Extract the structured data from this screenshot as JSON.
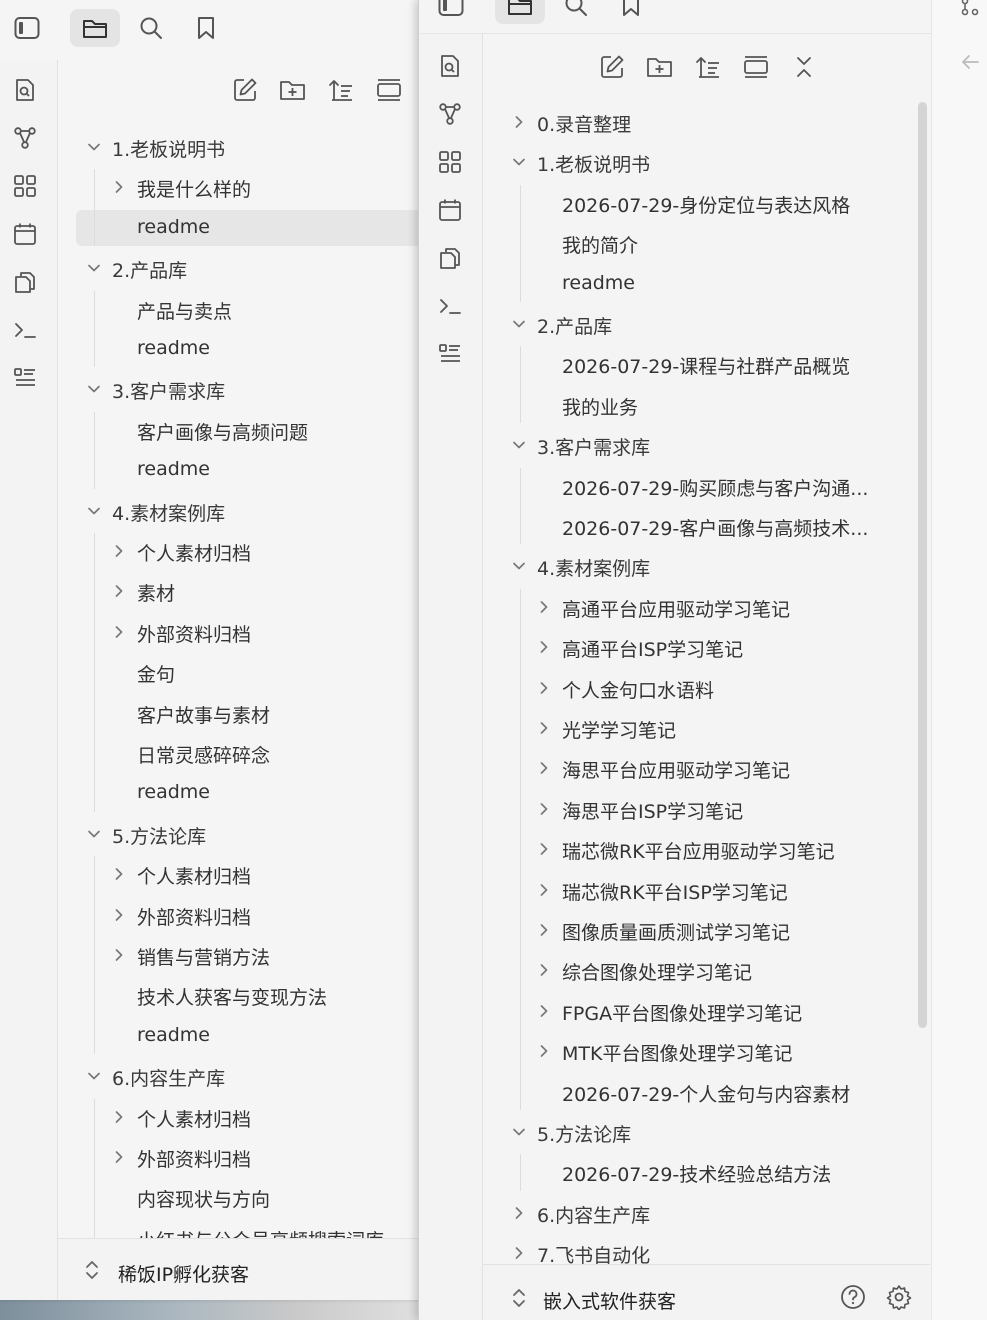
{
  "window_left": {
    "ribbon_icons": [
      "search-file-icon",
      "graph-icon",
      "canvas-icon",
      "calendar-icon",
      "copy-icon",
      "terminal-icon",
      "list-icon"
    ],
    "top_tabs": [
      "sidebar-toggle-icon",
      "folder-icon",
      "search-icon",
      "bookmark-icon"
    ],
    "nav_buttons": [
      "new-note-icon",
      "new-folder-icon",
      "sort-icon",
      "collapse-icon"
    ],
    "tree": [
      {
        "label": "1.老板说明书",
        "level": 0,
        "chevron": "down"
      },
      {
        "label": "我是什么样的",
        "level": 1,
        "chevron": "right"
      },
      {
        "label": "readme",
        "level": 1,
        "chevron": "none",
        "selected": true
      },
      {
        "label": "2.产品库",
        "level": 0,
        "chevron": "down"
      },
      {
        "label": "产品与卖点",
        "level": 1,
        "chevron": "none"
      },
      {
        "label": "readme",
        "level": 1,
        "chevron": "none"
      },
      {
        "label": "3.客户需求库",
        "level": 0,
        "chevron": "down"
      },
      {
        "label": "客户画像与高频问题",
        "level": 1,
        "chevron": "none"
      },
      {
        "label": "readme",
        "level": 1,
        "chevron": "none"
      },
      {
        "label": "4.素材案例库",
        "level": 0,
        "chevron": "down"
      },
      {
        "label": "个人素材归档",
        "level": 1,
        "chevron": "right"
      },
      {
        "label": "素材",
        "level": 1,
        "chevron": "right"
      },
      {
        "label": "外部资料归档",
        "level": 1,
        "chevron": "right"
      },
      {
        "label": "金句",
        "level": 1,
        "chevron": "none"
      },
      {
        "label": "客户故事与素材",
        "level": 1,
        "chevron": "none"
      },
      {
        "label": "日常灵感碎碎念",
        "level": 1,
        "chevron": "none"
      },
      {
        "label": "readme",
        "level": 1,
        "chevron": "none"
      },
      {
        "label": "5.方法论库",
        "level": 0,
        "chevron": "down"
      },
      {
        "label": "个人素材归档",
        "level": 1,
        "chevron": "right"
      },
      {
        "label": "外部资料归档",
        "level": 1,
        "chevron": "right"
      },
      {
        "label": "销售与营销方法",
        "level": 1,
        "chevron": "right"
      },
      {
        "label": "技术人获客与变现方法",
        "level": 1,
        "chevron": "none"
      },
      {
        "label": "readme",
        "level": 1,
        "chevron": "none"
      },
      {
        "label": "6.内容生产库",
        "level": 0,
        "chevron": "down"
      },
      {
        "label": "个人素材归档",
        "level": 1,
        "chevron": "right"
      },
      {
        "label": "外部资料归档",
        "level": 1,
        "chevron": "right"
      },
      {
        "label": "内容现状与方向",
        "level": 1,
        "chevron": "none"
      },
      {
        "label": "小红书与公众号高频搜索词库",
        "level": 1,
        "chevron": "none"
      }
    ],
    "vault_name": "稀饭IP孵化获客"
  },
  "window_right": {
    "ribbon_icons": [
      "search-file-icon",
      "graph-icon",
      "canvas-icon",
      "calendar-icon",
      "copy-icon",
      "terminal-icon",
      "list-icon"
    ],
    "nav_buttons": [
      "new-note-icon",
      "new-folder-icon",
      "sort-icon",
      "collapse-icon",
      "collapse-all-icon"
    ],
    "tree": [
      {
        "label": "0.录音整理",
        "level": 0,
        "chevron": "right"
      },
      {
        "label": "1.老板说明书",
        "level": 0,
        "chevron": "down"
      },
      {
        "label": "2026-07-29-身份定位与表达风格",
        "level": 1,
        "chevron": "none"
      },
      {
        "label": "我的简介",
        "level": 1,
        "chevron": "none"
      },
      {
        "label": "readme",
        "level": 1,
        "chevron": "none"
      },
      {
        "label": "2.产品库",
        "level": 0,
        "chevron": "down"
      },
      {
        "label": "2026-07-29-课程与社群产品概览",
        "level": 1,
        "chevron": "none"
      },
      {
        "label": "我的业务",
        "level": 1,
        "chevron": "none"
      },
      {
        "label": "3.客户需求库",
        "level": 0,
        "chevron": "down"
      },
      {
        "label": "2026-07-29-购买顾虑与客户沟通...",
        "level": 1,
        "chevron": "none"
      },
      {
        "label": "2026-07-29-客户画像与高频技术...",
        "level": 1,
        "chevron": "none"
      },
      {
        "label": "4.素材案例库",
        "level": 0,
        "chevron": "down"
      },
      {
        "label": "高通平台应用驱动学习笔记",
        "level": 1,
        "chevron": "right"
      },
      {
        "label": "高通平台ISP学习笔记",
        "level": 1,
        "chevron": "right"
      },
      {
        "label": "个人金句口水语料",
        "level": 1,
        "chevron": "right"
      },
      {
        "label": "光学学习笔记",
        "level": 1,
        "chevron": "right"
      },
      {
        "label": "海思平台应用驱动学习笔记",
        "level": 1,
        "chevron": "right"
      },
      {
        "label": "海思平台ISP学习笔记",
        "level": 1,
        "chevron": "right"
      },
      {
        "label": "瑞芯微RK平台应用驱动学习笔记",
        "level": 1,
        "chevron": "right"
      },
      {
        "label": "瑞芯微RK平台ISP学习笔记",
        "level": 1,
        "chevron": "right"
      },
      {
        "label": "图像质量画质测试学习笔记",
        "level": 1,
        "chevron": "right"
      },
      {
        "label": "综合图像处理学习笔记",
        "level": 1,
        "chevron": "right"
      },
      {
        "label": "FPGA平台图像处理学习笔记",
        "level": 1,
        "chevron": "right"
      },
      {
        "label": "MTK平台图像处理学习笔记",
        "level": 1,
        "chevron": "right"
      },
      {
        "label": "2026-07-29-个人金句与内容素材",
        "level": 1,
        "chevron": "none"
      },
      {
        "label": "5.方法论库",
        "level": 0,
        "chevron": "down"
      },
      {
        "label": "2026-07-29-技术经验总结方法",
        "level": 1,
        "chevron": "none"
      },
      {
        "label": "6.内容生产库",
        "level": 0,
        "chevron": "right"
      },
      {
        "label": "7.飞书自动化",
        "level": 0,
        "chevron": "right"
      }
    ],
    "vault_name": "嵌入式软件获客"
  }
}
